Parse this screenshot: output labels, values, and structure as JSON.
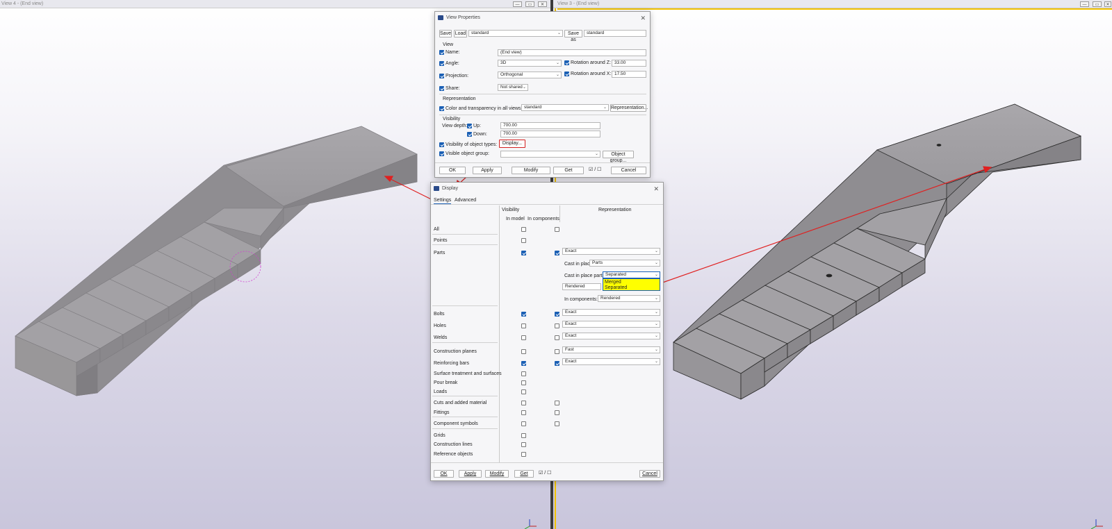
{
  "left_view": {
    "title": "View 4 - (End view)"
  },
  "right_view": {
    "title": "View 3 - (End view)"
  },
  "view_properties": {
    "title": "View Properties",
    "save": "Save",
    "load": "Load",
    "preset": "standard",
    "save_as": "Save as",
    "save_as_value": "standard",
    "view_section": "View",
    "name_label": "Name:",
    "name_value": "(End view)",
    "angle_label": "Angle:",
    "angle_value": "3D",
    "rot_z_label": "Rotation around Z:",
    "rot_z_value": "33.00",
    "projection_label": "Projection:",
    "projection_value": "Orthogonal",
    "rot_x_label": "Rotation around X:",
    "rot_x_value": "17.50",
    "share_label": "Share:",
    "share_value": "Not shared",
    "representation_section": "Representation",
    "color_label": "Color and transparency in all views:",
    "color_value": "standard",
    "representation_btn": "Representation...",
    "visibility_section": "Visibility",
    "view_depth_label": "View depth:",
    "up_label": "Up:",
    "up_value": "700.00",
    "down_label": "Down:",
    "down_value": "700.00",
    "vis_types_label": "Visibility of object types:",
    "display_btn": "Display...",
    "group_label": "Visible object group:",
    "object_group_btn": "Object group...",
    "ok": "OK",
    "apply": "Apply",
    "modify": "Modify",
    "get": "Get",
    "cancel": "Cancel"
  },
  "display": {
    "title": "Display",
    "tabs": [
      "Settings",
      "Advanced"
    ],
    "col_visibility": "Visibility",
    "col_in_model": "In model",
    "col_in_components": "In components",
    "col_representation": "Representation",
    "rows": {
      "all": "All",
      "points": "Points",
      "parts": "Parts",
      "bolts": "Bolts",
      "holes": "Holes",
      "welds": "Welds",
      "construction_planes": "Construction planes",
      "reinforcing_bars": "Reinforcing bars",
      "surface_treatment": "Surface treatment and surfaces",
      "pour_break": "Pour break",
      "loads": "Loads",
      "cuts": "Cuts and added material",
      "fittings": "Fittings",
      "component_symbols": "Component symbols",
      "grids": "Grids",
      "construction_lines": "Construction lines",
      "reference_objects": "Reference objects"
    },
    "parts_rep": "Exact",
    "cast_in_place_label": "Cast in place",
    "cast_in_place_value": "Parts",
    "cip_parts_label": "Cast in place parts",
    "cip_parts_value": "Separated",
    "rendered_value": "Rendered",
    "in_components_label": "In components:",
    "in_components_value": "Rendered",
    "dropdown_options": [
      "Merged",
      "Separated"
    ],
    "bolts_rep": "Exact",
    "holes_rep": "Exact",
    "welds_rep": "Exact",
    "planes_rep": "Fast",
    "rebar_rep": "Exact",
    "ok": "OK",
    "apply": "Apply",
    "modify": "Modify",
    "get": "Get",
    "cancel": "Cancel"
  },
  "colors": {
    "accent": "#1a5fb4",
    "annotation": "#e02020",
    "highlight": "#ffff00",
    "model_gray": "#9c9a9e"
  }
}
